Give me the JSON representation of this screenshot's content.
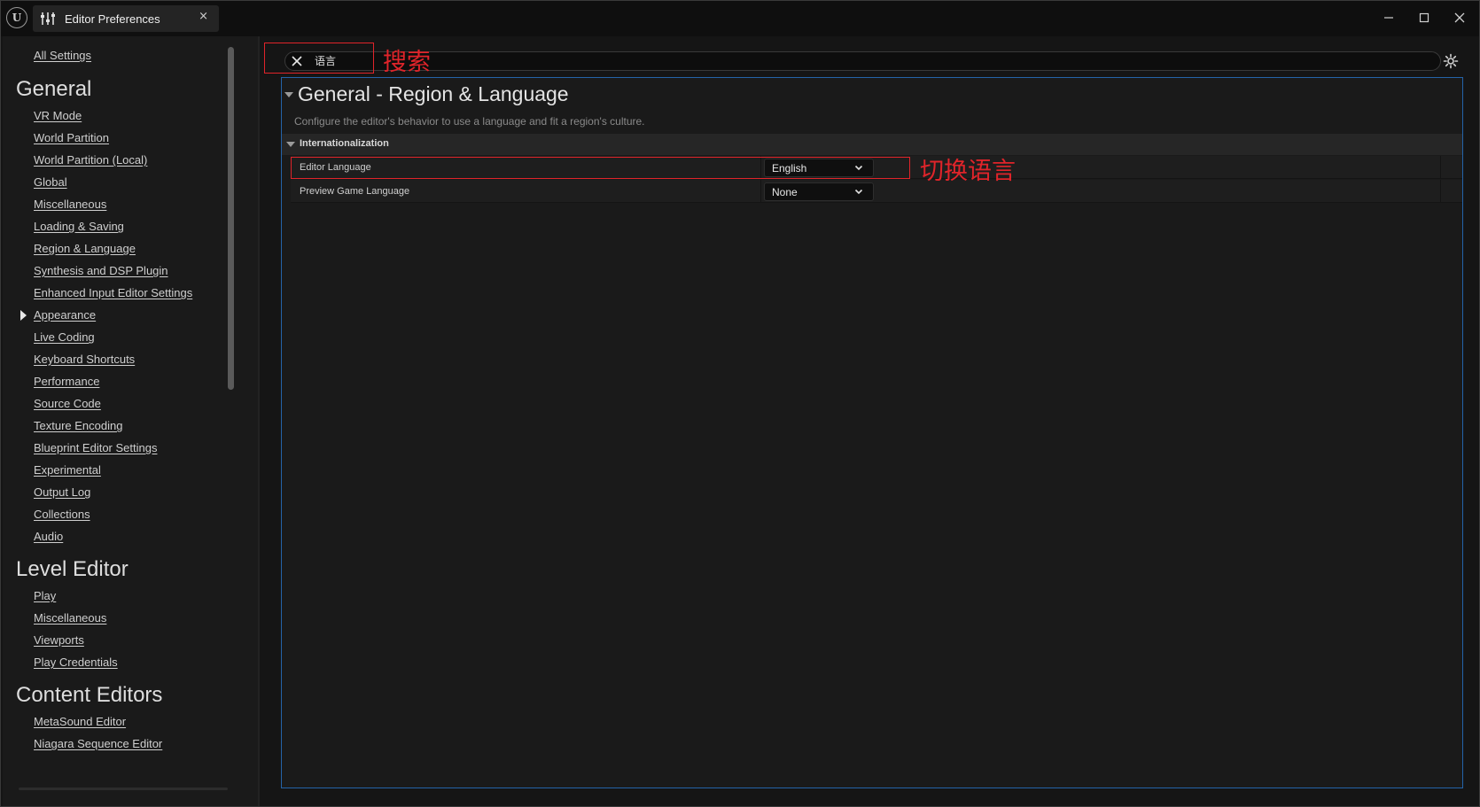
{
  "window": {
    "tab_title": "Editor Preferences",
    "tab_close": "×"
  },
  "search": {
    "value": "语言",
    "annotation": "搜索"
  },
  "sidebar": {
    "all_settings": "All Settings",
    "sections": [
      {
        "title": "General",
        "items": [
          "VR Mode",
          "World Partition",
          "World Partition (Local)",
          "Global",
          "Miscellaneous",
          "Loading & Saving",
          "Region & Language",
          "Synthesis and DSP Plugin",
          "Enhanced Input Editor Settings",
          "Appearance",
          "Live Coding",
          "Keyboard Shortcuts",
          "Performance",
          "Source Code",
          "Texture Encoding",
          "Blueprint Editor Settings",
          "Experimental",
          "Output Log",
          "Collections",
          "Audio"
        ]
      },
      {
        "title": "Level Editor",
        "items": [
          "Play",
          "Miscellaneous",
          "Viewports",
          "Play Credentials"
        ]
      },
      {
        "title": "Content Editors",
        "items": [
          "MetaSound Editor",
          "Niagara Sequence Editor"
        ]
      }
    ]
  },
  "details": {
    "section_title": "General - Region & Language",
    "section_description": "Configure the editor's behavior to use a language and fit a region's culture.",
    "category": "Internationalization",
    "properties": [
      {
        "label": "Editor Language",
        "value": "English"
      },
      {
        "label": "Preview Game Language",
        "value": "None"
      }
    ],
    "language_annotation": "切换语言"
  },
  "colors": {
    "annotation_red": "#e0242a",
    "selection_border": "#2463a8",
    "background": "#1a1a1a"
  },
  "icons": [
    "unreal-logo-icon",
    "sliders-icon",
    "close-icon",
    "minimize-icon",
    "maximize-icon",
    "window-close-icon",
    "clear-search-icon",
    "gear-icon",
    "chevron-down-icon",
    "expand-arrow-icon",
    "collapse-arrow-icon"
  ]
}
